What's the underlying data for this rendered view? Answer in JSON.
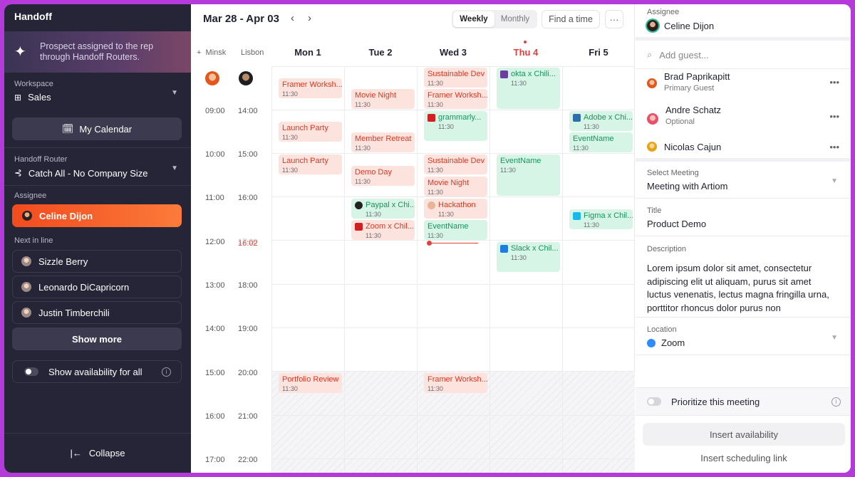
{
  "sidebar": {
    "title": "Handoff",
    "banner": "Prospect assigned to the rep through Handoff Routers.",
    "workspace_label": "Workspace",
    "workspace_value": "Sales",
    "calendar_button": "My Calendar",
    "router_label": "Handoff Router",
    "router_value": "Catch All - No Company Size",
    "assignee_label": "Assignee",
    "assignee": "Celine Dijon",
    "next_label": "Next in line",
    "next_in_line": [
      "Sizzle Berry",
      "Leonardo DiCapricorn",
      "Justin Timberchili"
    ],
    "show_more": "Show more",
    "availability_toggle": "Show availability for all",
    "collapse": "Collapse"
  },
  "calendar": {
    "date_range": "Mar 28 - Apr 03",
    "view_weekly": "Weekly",
    "view_monthly": "Monthly",
    "find_time": "Find a time",
    "more": "···",
    "tz1": "Minsk",
    "tz2": "Lisbon",
    "days": [
      "Mon 1",
      "Tue 2",
      "Wed 3",
      "Thu 4",
      "Fri 5"
    ],
    "times_minsk": [
      "09:00",
      "10:00",
      "11:00",
      "12:00",
      "13:00",
      "14:00",
      "15:00",
      "16:00",
      "17:00"
    ],
    "times_lisbon": [
      "14:00",
      "15:00",
      "16:00",
      "17:00",
      "18:00",
      "19:00",
      "20:00",
      "21:00",
      "22:00"
    ],
    "now_time": "16:02",
    "events": {
      "mon_framer": {
        "title": "Framer Worksh...",
        "time": "11:30"
      },
      "mon_launch1": {
        "title": "Launch Party",
        "time": "11:30"
      },
      "mon_launch2": {
        "title": "Launch Party",
        "time": "11:30"
      },
      "mon_portfolio": {
        "title": "Portfolio Review",
        "time": "11:30"
      },
      "tue_movie": {
        "title": "Movie Night",
        "time": "11:30"
      },
      "tue_retreat": {
        "title": "Member Retreat",
        "time": "11:30"
      },
      "tue_demo": {
        "title": "Demo Day",
        "time": "11:30"
      },
      "tue_paypal": {
        "title": "Paypal x Chi...",
        "time": "11:30"
      },
      "tue_zoom": {
        "title": "Zoom x Chil...",
        "time": "11:30"
      },
      "wed_sust1": {
        "title": "Sustainable Dev",
        "time": "11:30"
      },
      "wed_framer1": {
        "title": "Framer Worksh...",
        "time": "11:30"
      },
      "wed_grammarly": {
        "title": "grammarly...",
        "time": "11:30"
      },
      "wed_sust2": {
        "title": "Sustainable Dev",
        "time": "11:30"
      },
      "wed_movie": {
        "title": "Movie Night",
        "time": "11:30"
      },
      "wed_hackathon": {
        "title": "Hackathon",
        "time": "11:30"
      },
      "wed_event": {
        "title": "EventName",
        "time": "11:30"
      },
      "wed_framer2": {
        "title": "Framer Worksh...",
        "time": "11:30"
      },
      "thu_okta": {
        "title": "okta x Chili...",
        "time": "11:30"
      },
      "thu_event": {
        "title": "EventName",
        "time": "11:30"
      },
      "thu_slack": {
        "title": "Slack x Chil...",
        "time": "11:30"
      },
      "fri_adobe": {
        "title": "Adobe x Chi...",
        "time": "11:30"
      },
      "fri_event": {
        "title": "EventName",
        "time": "11:30"
      },
      "fri_figma": {
        "title": "Figma x Chil...",
        "time": "11:30"
      }
    }
  },
  "panel": {
    "assignee_label": "Assignee",
    "assignee": "Celine Dijon",
    "add_guest_placeholder": "Add guest...",
    "guests": [
      {
        "name": "Brad Paprikapitt",
        "role": "Primary Guest"
      },
      {
        "name": "Andre Schatz",
        "role": "Optional"
      },
      {
        "name": "Nicolas Cajun",
        "role": ""
      }
    ],
    "meeting_label": "Select Meeting",
    "meeting_value": "Meeting with Artiom",
    "title_label": "Title",
    "title_value": "Product Demo",
    "description_label": "Description",
    "description_value": "Lorem ipsum dolor sit amet, consectetur adipiscing elit ut aliquam, purus sit amet luctus venenatis, lectus magna fringilla urna, porttitor rhoncus dolor purus non",
    "location_label": "Location",
    "location_value": "Zoom",
    "prioritize": "Prioritize this meeting",
    "insert_availability": "Insert availability",
    "insert_link": "Insert scheduling link"
  },
  "colors": {
    "accent": "#f24b1e",
    "event_red_bg": "#fde3dd",
    "event_green_bg": "#d7f5e6",
    "today": "#e0413a",
    "frame": "#b43ad9"
  }
}
